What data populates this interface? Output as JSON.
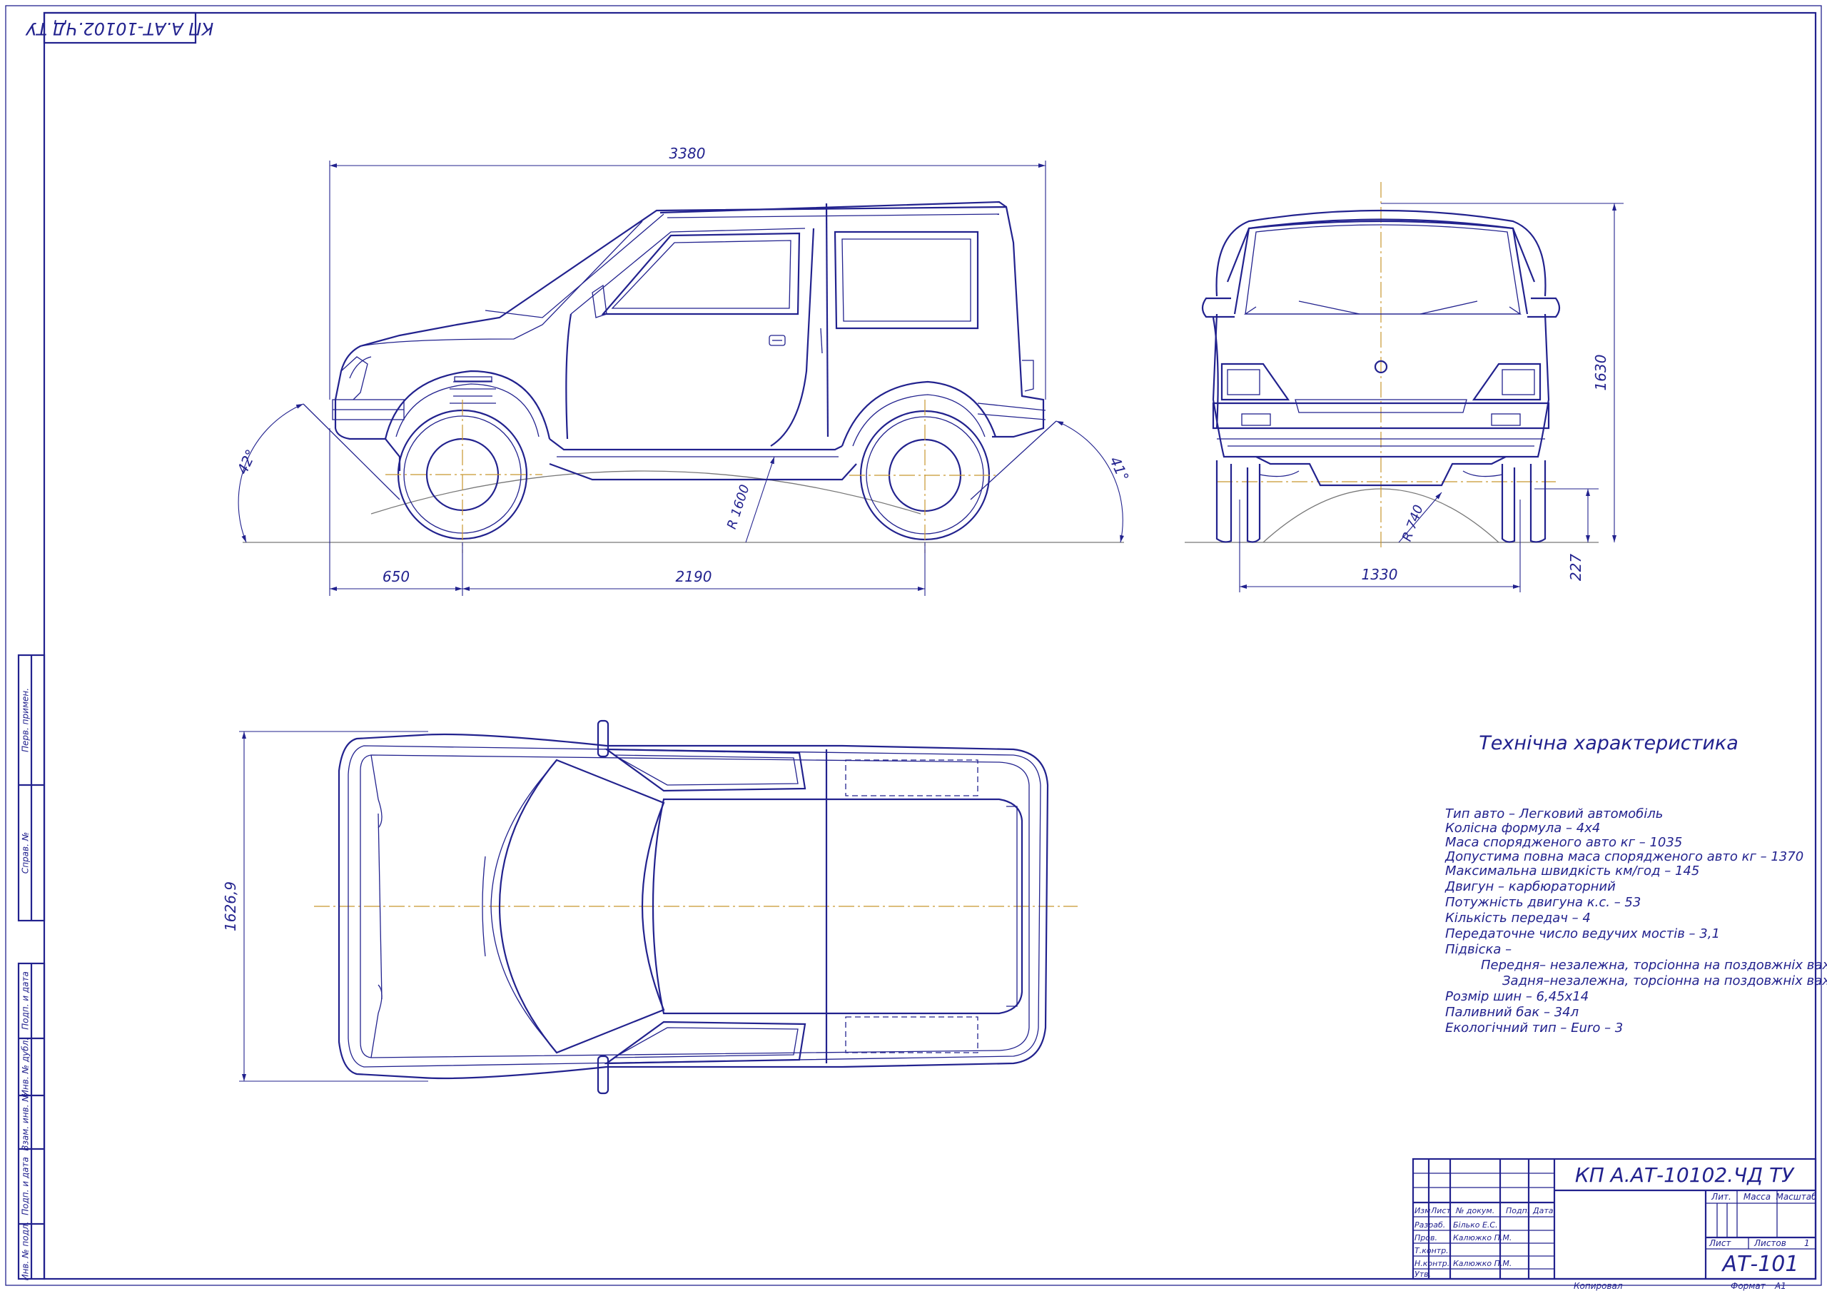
{
  "drawing": {
    "corner_stamp": "КП А.АТ-10102.ЧД ТУ",
    "colors": {
      "line": "#22228e",
      "axis": "#c8962e",
      "ground": "#777777"
    }
  },
  "side_view": {
    "dims": {
      "overall_length": "3380",
      "front_overhang": "650",
      "wheelbase": "2190",
      "approach_angle": "42°",
      "departure_angle": "41°",
      "ramp_radius": "R 1600"
    }
  },
  "front_view": {
    "dims": {
      "height": "1630",
      "track": "1330",
      "clearance": "227",
      "radius": "R 740"
    }
  },
  "top_view": {
    "dims": {
      "width": "1626,9"
    }
  },
  "specs": {
    "title": "Технічна характеристика",
    "lines": [
      "Тип авто – Легковий автомобіль",
      "Колісна формула – 4х4",
      "Маса спорядженого авто кг – 1035",
      "Допустима повна маса спорядженого авто кг – 1370",
      "Максимальна швидкість км/год – 145",
      "Двигун – карбюраторний",
      "Потужність двигуна к.с. – 53",
      "Кількість передач – 4",
      "Передаточне число ведучих мостів – 3,1",
      "Підвіска –",
      "Передня– незалежна, торсіонна на поздовжніх важелях,",
      "Задня–незалежна, торсіонна на поздовжніх важелях,",
      "Розмір шин – 6,45х14",
      "Паливний бак – 34л",
      "Екологічний тип – Euro – 3"
    ]
  },
  "title_block": {
    "code": "КП А.АТ-10102.ЧД ТУ",
    "designation": "АТ-101",
    "headers": {
      "change": "Изм",
      "sheet": "Лист",
      "doc": "№ докум.",
      "sign": "Подп.",
      "date": "Дата",
      "lit": "Лит.",
      "mass": "Масса",
      "scale": "Масштаб",
      "sheet2": "Лист",
      "sheets": "Листов",
      "sheets_count": "1"
    },
    "roles": [
      {
        "role": "Разраб.",
        "name": "Білько Е.С."
      },
      {
        "role": "Пров.",
        "name": "Калюжко П.М."
      },
      {
        "role": "Т.контр.",
        "name": ""
      },
      {
        "role": "Н.контр.",
        "name": "Калюжко П.М."
      },
      {
        "role": "Утв.",
        "name": ""
      }
    ],
    "copied": "Копировал",
    "format_label": "Формат",
    "format_value": "А1"
  },
  "side_strip": [
    "Перв. примен.",
    "Справ. №",
    "Подп. и дата",
    "Инв. № дубл.",
    "Взам. инв. №",
    "Подп. и дата",
    "Инв. № подл."
  ]
}
